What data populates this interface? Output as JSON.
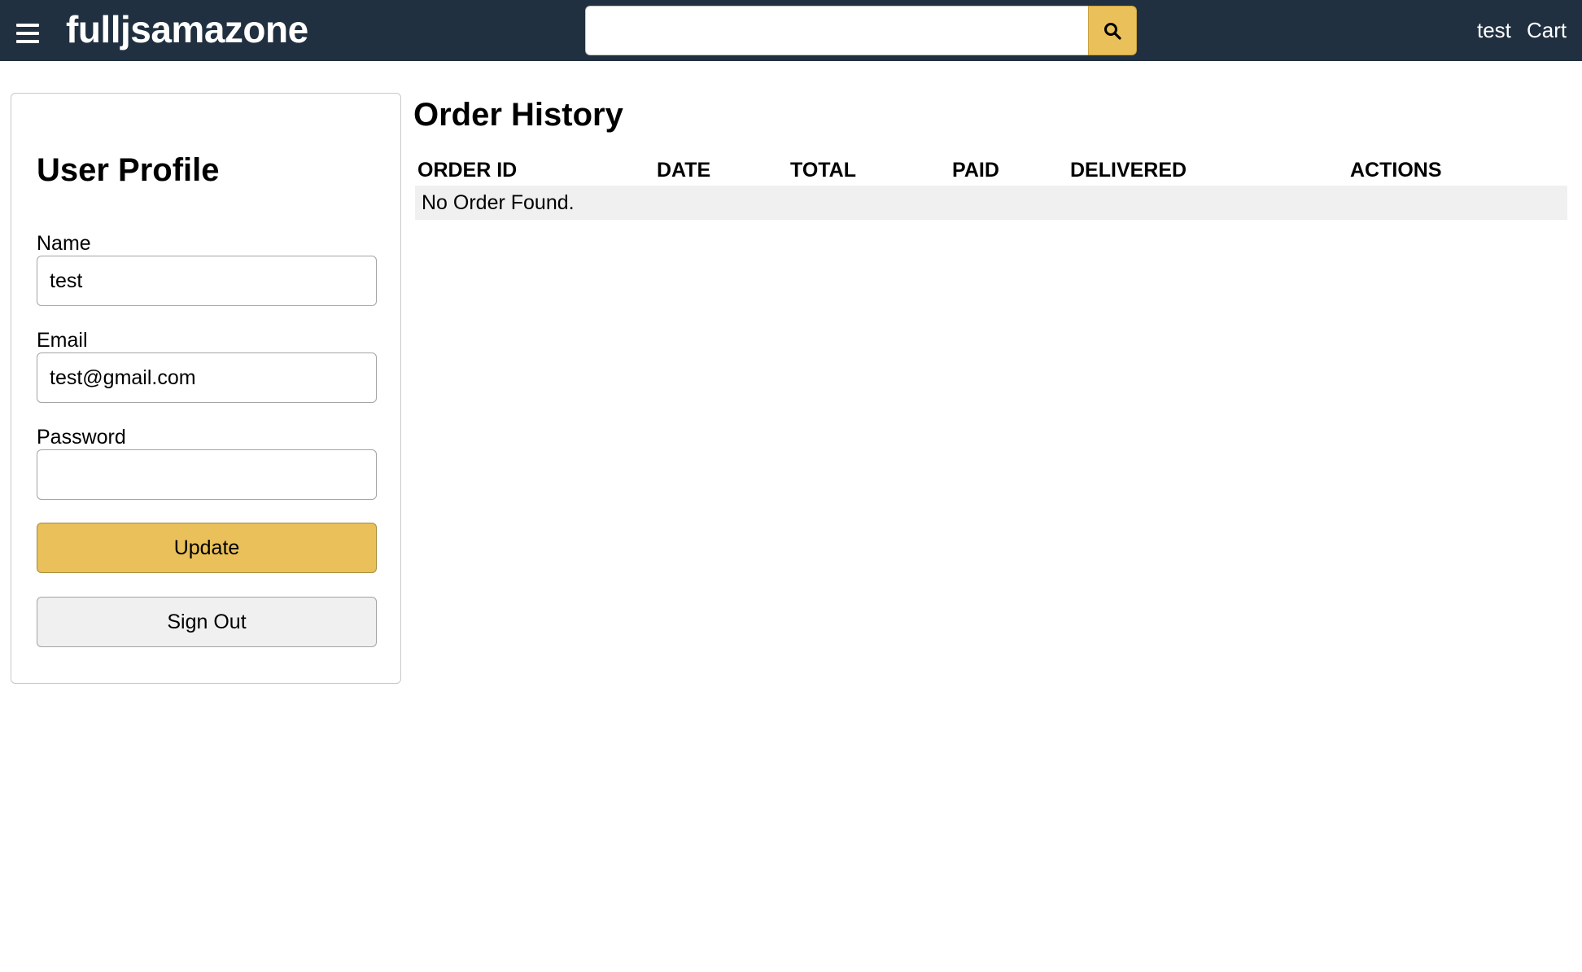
{
  "header": {
    "brand": "fulljsamazone",
    "search": {
      "value": "",
      "placeholder": ""
    },
    "nav": {
      "user": "test",
      "cart": "Cart"
    }
  },
  "profile": {
    "title": "User Profile",
    "fields": {
      "name": {
        "label": "Name",
        "value": "test"
      },
      "email": {
        "label": "Email",
        "value": "test@gmail.com"
      },
      "password": {
        "label": "Password",
        "value": ""
      }
    },
    "update_label": "Update",
    "signout_label": "Sign Out"
  },
  "orders": {
    "title": "Order History",
    "columns": [
      "ORDER ID",
      "DATE",
      "TOTAL",
      "PAID",
      "DELIVERED",
      "ACTIONS"
    ],
    "empty_message": "No Order Found."
  },
  "colors": {
    "header_bg": "#203040",
    "accent": "#e9c05a",
    "row_bg": "#f0f0f0"
  },
  "icons": {
    "menu": "hamburger-icon",
    "search": "search-icon"
  }
}
